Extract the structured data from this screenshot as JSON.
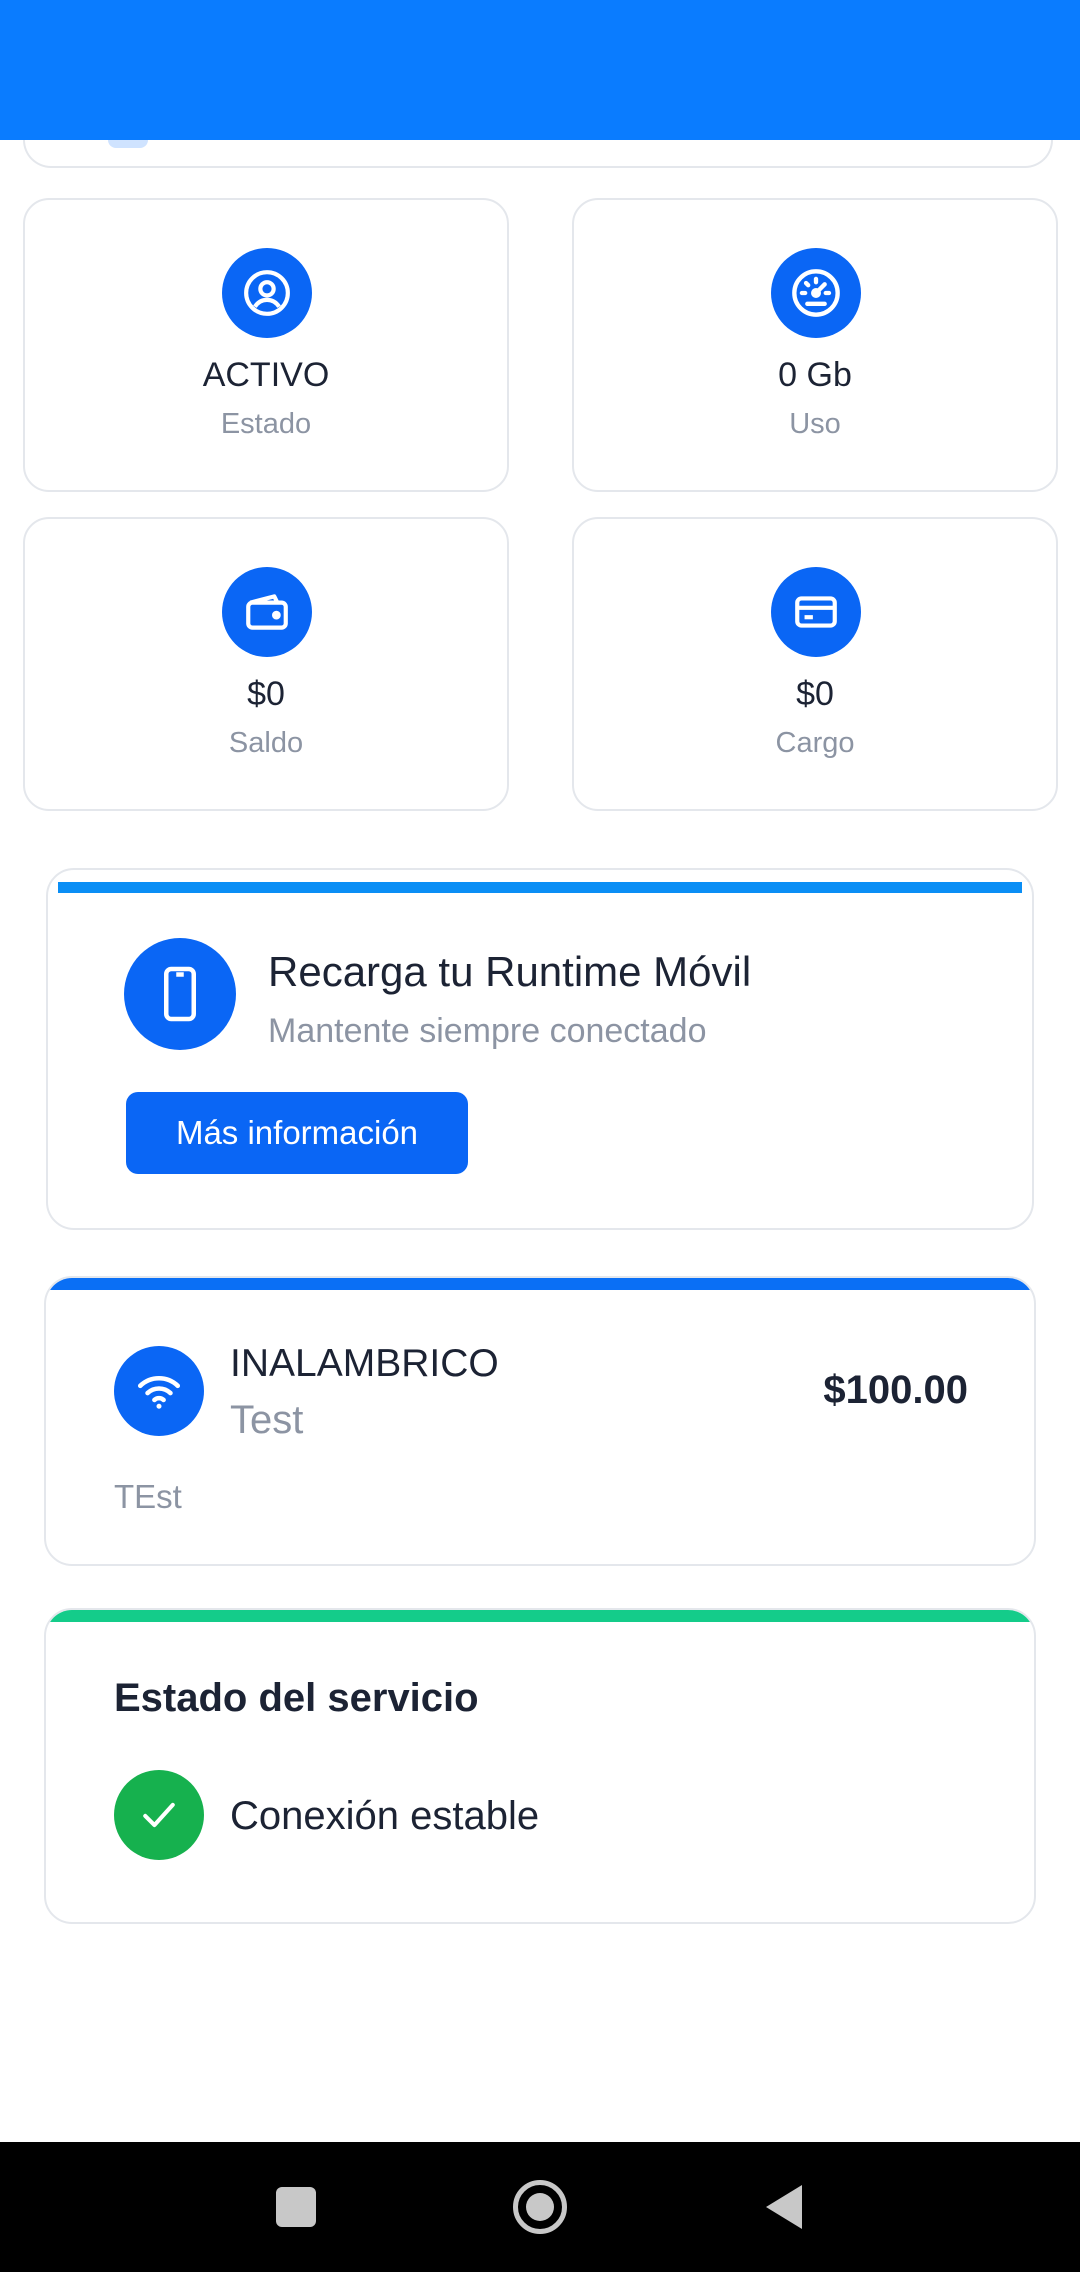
{
  "colors": {
    "header": "#0a7cff",
    "accent": "#0a66f5",
    "promo_bar": "#0a8ef5",
    "status_bar": "#14cc8a",
    "success": "#16b14e"
  },
  "stats": [
    {
      "value": "ACTIVO",
      "label": "Estado",
      "icon": "user-circle-icon"
    },
    {
      "value": "0 Gb",
      "label": "Uso",
      "icon": "speedometer-icon"
    },
    {
      "value": "$0",
      "label": "Saldo",
      "icon": "wallet-icon"
    },
    {
      "value": "$0",
      "label": "Cargo",
      "icon": "credit-card-icon"
    }
  ],
  "promo": {
    "title": "Recarga tu Runtime Móvil",
    "subtitle": "Mantente siempre conectado",
    "button_label": "Más información",
    "icon": "smartphone-icon"
  },
  "plan": {
    "name": "INALAMBRICO",
    "type": "Test",
    "price": "$100.00",
    "description": "TEst",
    "icon": "wifi-icon"
  },
  "service_status": {
    "title": "Estado del servicio",
    "message": "Conexión estable",
    "icon": "check-icon"
  },
  "system_nav": {
    "buttons": [
      "recents-icon",
      "home-icon",
      "back-icon"
    ]
  }
}
